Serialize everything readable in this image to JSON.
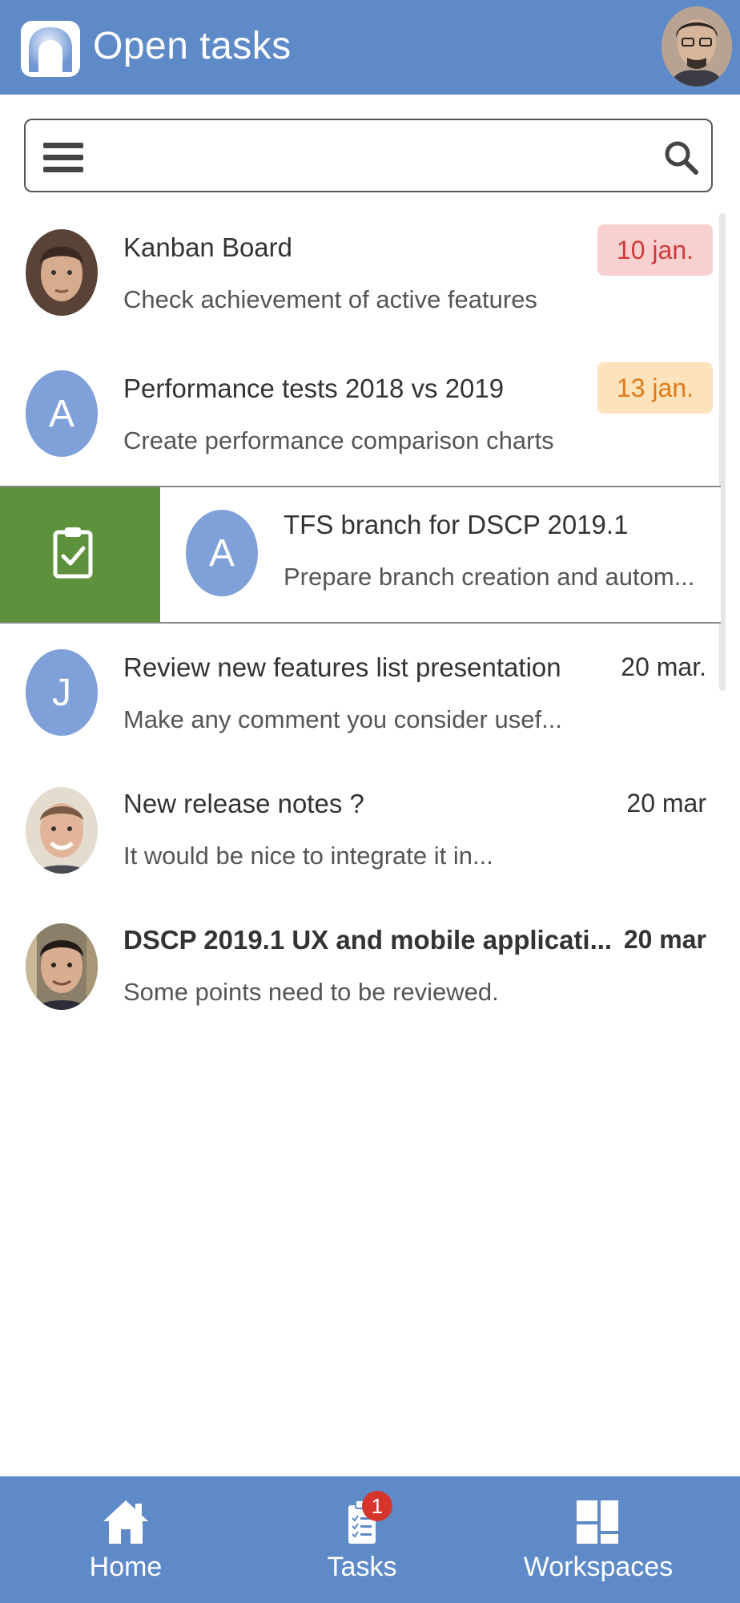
{
  "header": {
    "title": "Open tasks"
  },
  "search": {
    "value": ""
  },
  "tasks": [
    {
      "title": "Kanban Board",
      "subtitle": "Check achievement of active features",
      "date": "10 jan.",
      "avatar": "photo"
    },
    {
      "title": "Performance tests 2018 vs 2019",
      "subtitle": "Create performance comparison charts",
      "date": "13 jan.",
      "avatar": "A"
    },
    {
      "title": "TFS branch for DSCP 2019.1",
      "subtitle": "Prepare branch creation and autom...",
      "date": "",
      "avatar": "A"
    },
    {
      "title": "Review new features list presentation",
      "subtitle": "Make any comment you consider usef...",
      "date": "20 mar.",
      "avatar": "J"
    },
    {
      "title": "New release notes ?",
      "subtitle": "It would be nice to integrate it in...",
      "date": "20 mar",
      "avatar": "photo"
    },
    {
      "title": "DSCP 2019.1 UX and mobile applicati...",
      "subtitle": "Some points need to be reviewed.",
      "date": "20 mar",
      "avatar": "photo"
    }
  ],
  "colors": {
    "header": "#5f8ac8",
    "badge_red_bg": "#f8d0d0",
    "badge_red_text": "#d03a3a",
    "badge_orange_bg": "#fde3bb",
    "badge_orange_text": "#e07a18",
    "swipe_green": "#5d913b",
    "letter_avatar": "#7fa0d8"
  },
  "nav": {
    "home": "Home",
    "tasks": "Tasks",
    "tasks_badge": "1",
    "workspaces": "Workspaces"
  }
}
